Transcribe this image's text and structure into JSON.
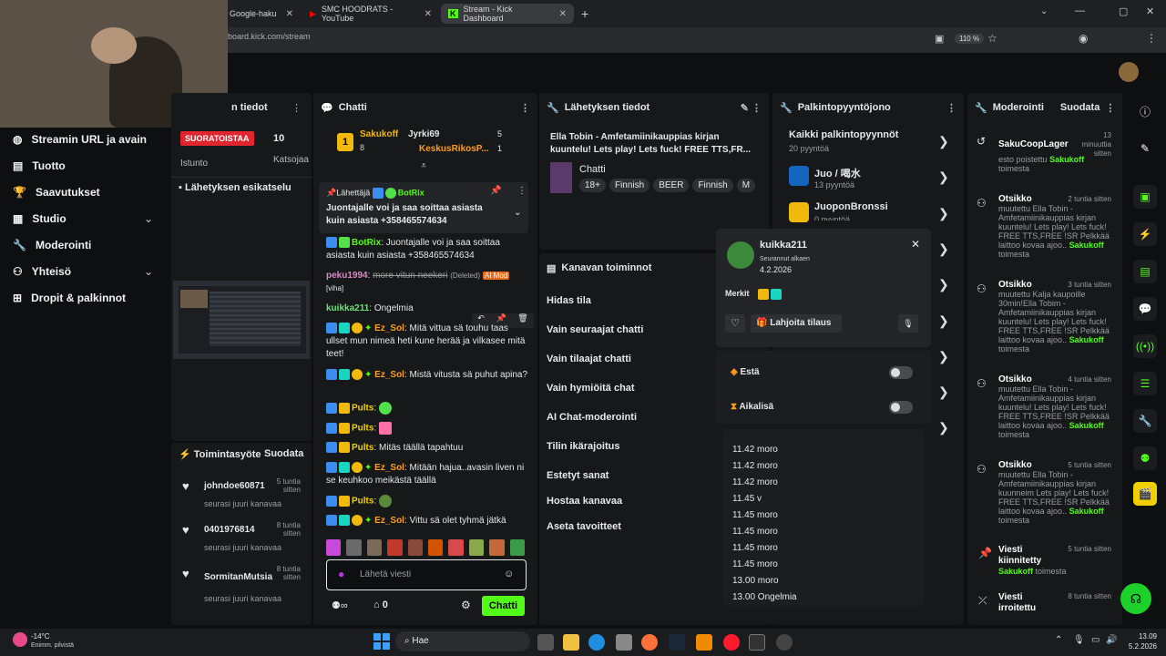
{
  "browser": {
    "tabs": [
      {
        "label": "Google-haku"
      },
      {
        "label": "SMC HOODRATS - YouTube"
      },
      {
        "label": "Stream - Kick Dashboard"
      }
    ],
    "url": "board.kick.com/stream",
    "zoom": "110 %"
  },
  "left_nav": {
    "items": [
      {
        "label": "Streamin URL ja avain"
      },
      {
        "label": "Tuotto"
      },
      {
        "label": "Saavutukset"
      },
      {
        "label": "Studio"
      },
      {
        "label": "Moderointi"
      },
      {
        "label": "Yhteisö"
      },
      {
        "label": "Dropit & palkinnot"
      }
    ]
  },
  "stream_info": {
    "title": "n tiedot",
    "live_badge": "SUORATOISTAA",
    "viewers": "10",
    "session_label": "Istunto",
    "viewers_label": "Katsojaa",
    "preview_title": "Lähetyksen esikatselu"
  },
  "activity": {
    "title": "Toimintasyöte",
    "filter": "Suodata",
    "items": [
      {
        "user": "johndoe60871",
        "time": "5 tuntia sitten",
        "text": "seurasi juuri kanavaa"
      },
      {
        "user": "0401976814",
        "time": "8 tuntia sitten",
        "text": "seurasi juuri kanavaa"
      },
      {
        "user": "SormitanMutsia",
        "time": "8 tuntia sitten",
        "text": "seurasi juuri kanavaa"
      }
    ]
  },
  "chat": {
    "title": "Chatti",
    "top": [
      {
        "name": "Sakukoff",
        "count": "8"
      },
      {
        "name": "Jyrki69",
        "count": "5"
      },
      {
        "name": "KeskusRikosP...",
        "count": "1"
      }
    ],
    "rank": "1",
    "pinned": {
      "label": "Lähettäjä",
      "user": "BotRix",
      "text": "Juontajalle voi ja saa soittaa asiasta kuin asiasta +358465574634"
    },
    "messages": [
      {
        "user": "BotRix",
        "text": "Juontajalle voi ja saa soittaa asiasta kuin asiasta +358465574634"
      },
      {
        "user": "peku1994",
        "text": "more vitun neekeri",
        "tag": "(Deleted)",
        "badge": "AI Mod",
        "extra": "[viha]"
      },
      {
        "user": "kuikka211",
        "text": "Ongelmia"
      },
      {
        "user": "Ez_Sol",
        "text": "Mitä vittua sä touhu taas ullset mun nimeä heti kune herää ja vilkasee mitä teet!"
      },
      {
        "user": "Ez_Sol",
        "text": "Mistä vitusta sä puhut apina?"
      },
      {
        "user": "Pults",
        "text": ""
      },
      {
        "user": "Pults",
        "text": ""
      },
      {
        "user": "Pults",
        "text": "Mitäs täällä tapahtuu"
      },
      {
        "user": "Ez_Sol",
        "text": "Mitään hajua..avasin liven ni se keuhkoo meikästä täällä"
      },
      {
        "user": "Pults",
        "text": ""
      },
      {
        "user": "Ez_Sol",
        "text": "Vittu sä olet tyhmä jätkä"
      }
    ],
    "input_placeholder": "Lähetä viesti",
    "points": "0",
    "send": "Chatti"
  },
  "broadcast": {
    "title": "Lähetyksen tiedot",
    "stream_title": "Ella Tobin - Amfetamiinikauppias kirjan kuuntelu! Lets play! Lets fuck! FREE TTS,FR...",
    "category": "Chatti",
    "tags": [
      "18+",
      "Finnish",
      "BEER",
      "Finnish",
      "M"
    ]
  },
  "channel_actions": {
    "title": "Kanavan toiminnot",
    "items": [
      "Hidas tila",
      "Vain seuraajat chatti",
      "Vain tilaajat chatti",
      "Vain hymiöitä chat",
      "AI Chat-moderointi",
      "Tilin ikärajoitus",
      "Estetyt sanat",
      "Hostaa kanavaa",
      "Aseta tavoitteet"
    ]
  },
  "rewards": {
    "title": "Palkintopyyntöjono",
    "all": "Kaikki palkintopyynnöt",
    "all_count": "20 pyyntöä",
    "items": [
      {
        "name": "Juo / 喝水",
        "count": "13 pyyntöä"
      },
      {
        "name": "JuoponBronssi",
        "count": "0 pyyntöä"
      }
    ]
  },
  "user_popup": {
    "name": "kuikka211",
    "follow_label": "Seurannut alkaen",
    "follow_date": "4.2.2026",
    "badges_label": "Merkit",
    "gift": "Lahjoita tilaus",
    "ban": "Estä",
    "timeout": "Aikalisä",
    "history": [
      "11.42 moro",
      "11.42 moro",
      "11.42 moro",
      "11.45 v",
      "11.45 moro",
      "11.45 moro",
      "11.45 moro",
      "11.45 moro",
      "13.00 moro",
      "13.00 Ongelmia"
    ]
  },
  "moderation": {
    "title": "Moderointi",
    "filter": "Suodata",
    "items": [
      {
        "title": "SakuCoopLager",
        "time": "13 minuuttia sitten",
        "text": "esto poistettu",
        "by": "Sakukoff",
        "suffix": "toimesta"
      },
      {
        "title": "Otsikko",
        "time": "2 tuntia sitten",
        "text": "muutettu Ella Tobin - Amfetamiinikauppias kirjan kuuntelu! Lets play! Lets fuck! FREE TTS,FREE !SR Pelkkää laittoo kovaa ajoo..",
        "by": "Sakukoff",
        "suffix": "toimesta"
      },
      {
        "title": "Otsikko",
        "time": "3 tuntia sitten",
        "text": "muutettu Kalja kaupoille 30min!Ella Tobim - Amfetamiinikauppias kirjan kuuntelu! Lets play! Lets fuck! FREE TTS,FREE !SR Pelkkää laittoo kovaa ajoo..",
        "by": "Sakukoff",
        "suffix": "toimesta"
      },
      {
        "title": "Otsikko",
        "time": "4 tuntia sitten",
        "text": "muutettu Ella Tobin - Amfetamiinikauppias kirjan kuuntelu! Lets play! Lets fuck! FREE TTS,FREE !SR Pelkkää laittoo kovaa ajoo..",
        "by": "Sakukoff",
        "suffix": "toimesta"
      },
      {
        "title": "Otsikko",
        "time": "5 tuntia sitten",
        "text": "muutettu Ella Tobin - Amfetamiinikauppias kirjan kuunneim Lets play! Lets fuck! FREE TTS,FREE !SR Pelkkää laittoo kovaa ajoo..",
        "by": "Sakukoff",
        "suffix": "toimesta"
      },
      {
        "title": "Viesti kiinnitetty",
        "time": "5 tuntia sitten",
        "text": "",
        "by": "Sakukoff",
        "suffix": "toimesta"
      },
      {
        "title": "Viesti irroitettu",
        "time": "8 tuntia sitten",
        "text": "",
        "by": "",
        "suffix": ""
      }
    ]
  },
  "taskbar": {
    "weather_temp": "-14°C",
    "weather_text": "Enimm. pilvistä",
    "search": "Hae",
    "time": "13.09",
    "date": "5.2.2026"
  }
}
